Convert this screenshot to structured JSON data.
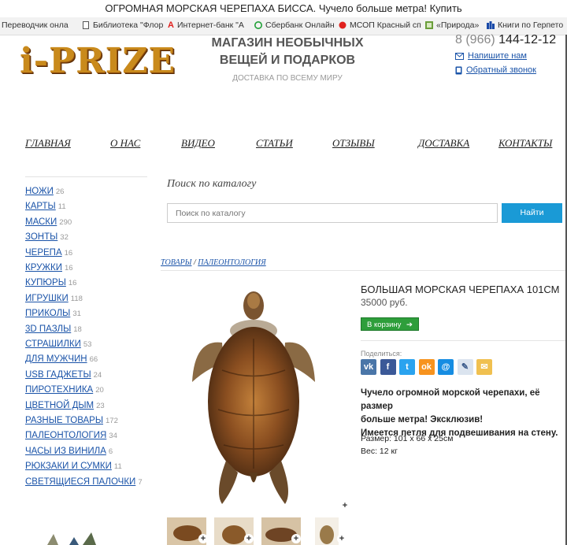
{
  "window": {
    "title": "ОГРОМНАЯ МОРСКАЯ ЧЕРЕПАХА БИССА. Чучело больше метра! Купить"
  },
  "bookmarks": [
    {
      "label": "Переводчик онла"
    },
    {
      "label": "Библиотека \"Флор"
    },
    {
      "label": "Интернет-банк \"А"
    },
    {
      "label": "Сбербанк Онлайн"
    },
    {
      "label": "МСОП Красный сп"
    },
    {
      "label": "«Природа»"
    },
    {
      "label": "Книги по Герпето"
    }
  ],
  "header": {
    "logo": "i-PRIZE",
    "tagline_1": "МАГАЗИН НЕОБЫЧНЫХ",
    "tagline_2": "ВЕЩЕЙ И ПОДАРКОВ",
    "subtag": "ДОСТАВКА ПО ВСЕМУ МИРУ",
    "phone_prefix": "8 (966)",
    "phone_number": "144-12-12",
    "write_us": "Напишите нам",
    "callback": "Обратный звонок"
  },
  "nav": [
    "ГЛАВНАЯ",
    "О НАС",
    "ВИДЕО",
    "СТАТЬИ",
    "ОТЗЫВЫ",
    "ДОСТАВКА",
    "КОНТАКТЫ"
  ],
  "categories": [
    {
      "name": "НОЖИ",
      "count": "26"
    },
    {
      "name": "КАРТЫ",
      "count": "11"
    },
    {
      "name": "МАСКИ",
      "count": "290"
    },
    {
      "name": "ЗОНТЫ",
      "count": "32"
    },
    {
      "name": "ЧЕРЕПА",
      "count": "16"
    },
    {
      "name": "КРУЖКИ",
      "count": "16"
    },
    {
      "name": "КУПЮРЫ",
      "count": "16"
    },
    {
      "name": "ИГРУШКИ",
      "count": "118"
    },
    {
      "name": "ПРИКОЛЫ",
      "count": "31"
    },
    {
      "name": "3D ПАЗЛЫ",
      "count": "18"
    },
    {
      "name": "СТРАШИЛКИ",
      "count": "53"
    },
    {
      "name": "ДЛЯ МУЖЧИН",
      "count": "66"
    },
    {
      "name": "USB ГАДЖЕТЫ",
      "count": "24"
    },
    {
      "name": "ПИРОТЕХНИКА",
      "count": "20"
    },
    {
      "name": "ЦВЕТНОЙ ДЫМ",
      "count": "23"
    },
    {
      "name": "РАЗНЫЕ ТОВАРЫ",
      "count": "172"
    },
    {
      "name": "ПАЛЕОНТОЛОГИЯ",
      "count": "34"
    },
    {
      "name": "ЧАСЫ ИЗ ВИНИЛА",
      "count": "6"
    },
    {
      "name": "РЮКЗАКИ И СУМКИ",
      "count": "11"
    },
    {
      "name": "СВЕТЯЩИЕСЯ ПАЛОЧКИ",
      "count": "7"
    }
  ],
  "search": {
    "title": "Поиск по каталогу",
    "placeholder": "Поиск по каталогу",
    "button": "Найти"
  },
  "breadcrumb": {
    "root": "ТОВАРЫ",
    "separator": "/",
    "current": "ПАЛЕОНТОЛОГИЯ"
  },
  "product": {
    "title": "БОЛЬШАЯ МОРСКАЯ ЧЕРЕПАХА 101СМ",
    "price": "35000 руб.",
    "cart_button": "В корзину",
    "share_label": "Поделиться:",
    "description_1": "Чучело огромной морской черепахи, её размер",
    "description_2": "больше метра! Эксклюзив!",
    "description_3": "Имеется петля для подвешивания на стену.",
    "size": "Размер: 101 х 66 х 25см",
    "weight": "Вес: 12 кг"
  },
  "social": [
    {
      "icon": "vk-icon",
      "glyph": "vk",
      "color": "#4a76a8"
    },
    {
      "icon": "facebook-icon",
      "glyph": "f",
      "color": "#3b5998"
    },
    {
      "icon": "twitter-icon",
      "glyph": "t",
      "color": "#2aa3ef"
    },
    {
      "icon": "odnoklassniki-icon",
      "glyph": "ok",
      "color": "#f7931e"
    },
    {
      "icon": "mailru-icon",
      "glyph": "@",
      "color": "#168de2"
    },
    {
      "icon": "livejournal-icon",
      "glyph": "✎",
      "color": "#dbe4ef"
    },
    {
      "icon": "email-icon",
      "glyph": "✉",
      "color": "#f0c050"
    }
  ],
  "colors": {
    "link": "#1a53a8",
    "search_button": "#1a9ad6",
    "cart_button": "#2e9e3b",
    "logo": "#c98a1c"
  }
}
